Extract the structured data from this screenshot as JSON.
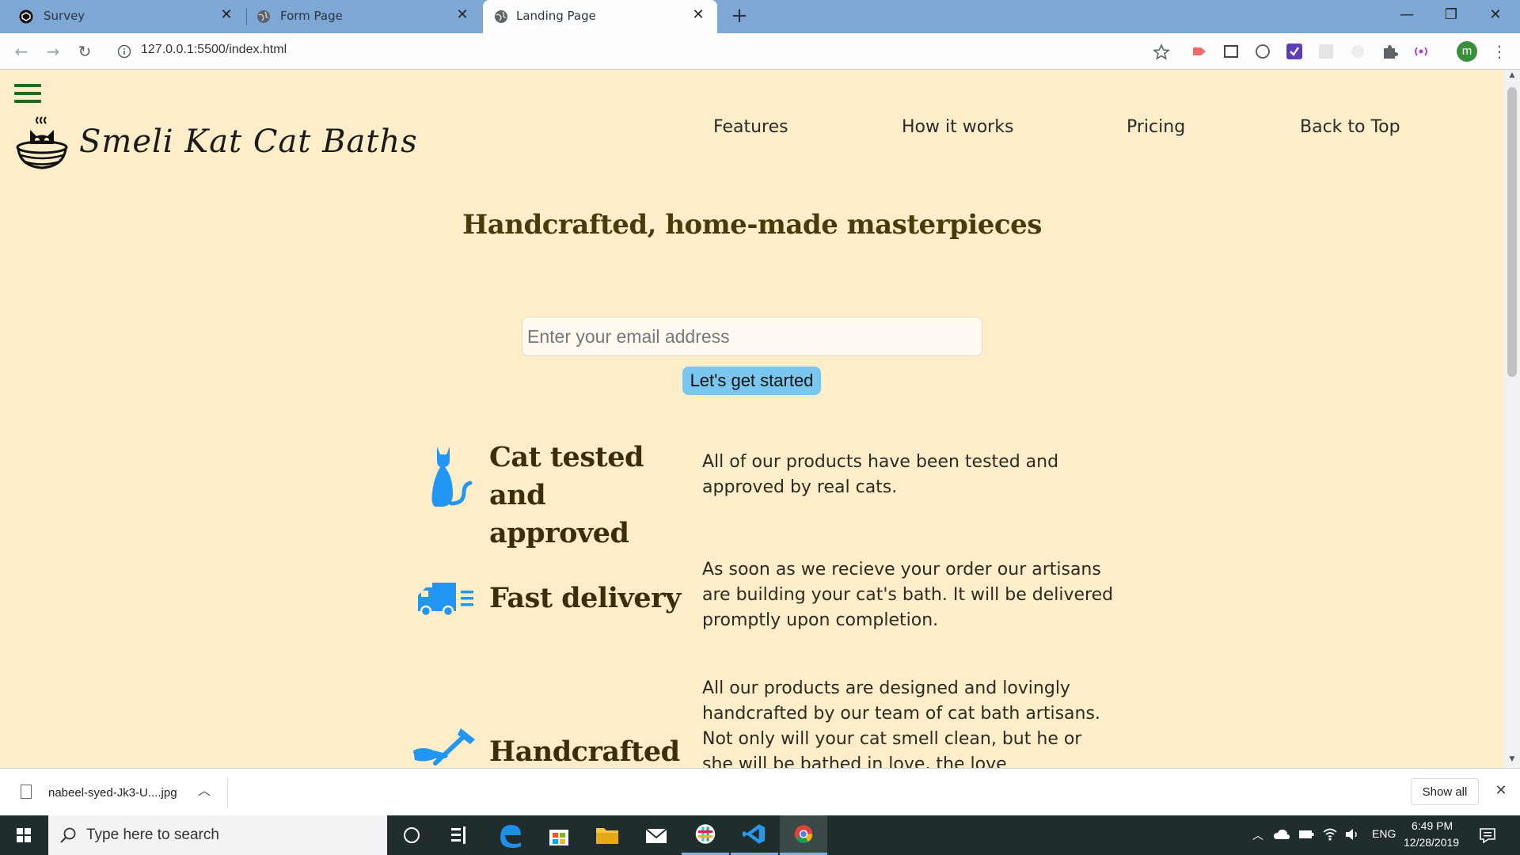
{
  "browser": {
    "tabs": [
      {
        "title": "Survey",
        "icon": "codepen-icon",
        "active": false
      },
      {
        "title": "Form Page",
        "icon": "globe-icon",
        "active": false
      },
      {
        "title": "Landing Page",
        "icon": "globe-icon",
        "active": true
      }
    ],
    "new_tab": "+",
    "url": "127.0.0.1:5500/index.html",
    "profile_initial": "m"
  },
  "site": {
    "name": "Smeli Kat Cat Baths",
    "nav": [
      "Features",
      "How it works",
      "Pricing",
      "Back to Top"
    ]
  },
  "hero": {
    "title": "Handcrafted, home-made masterpieces",
    "email_placeholder": "Enter your email address",
    "cta_label": "Let's get started"
  },
  "features": [
    {
      "icon": "cat-icon",
      "title": "Cat tested and approved",
      "description": "All of our products have been tested and approved by real cats."
    },
    {
      "icon": "delivery-truck-icon",
      "title": "Fast delivery",
      "description": "As soon as we recieve your order our artisans are building your cat's bath. It will be delivered promptly upon completion."
    },
    {
      "icon": "hammer-icon",
      "title": "Handcrafted",
      "description": "All our products are designed and lovingly handcrafted by our team of cat bath artisans. Not only will your cat smell clean, but he or she will be bathed in love, the love"
    }
  ],
  "downloads": {
    "file_name": "nabeel-syed-Jk3-U....jpg",
    "show_all": "Show all"
  },
  "taskbar": {
    "search_placeholder": "Type here to search",
    "language": "ENG",
    "time": "6:49 PM",
    "date": "12/28/2019"
  },
  "colors": {
    "page_background": "#fdedc8",
    "accent_blue": "#2196f3",
    "cta_button": "#79c6ee",
    "heading": "#4b3a0c",
    "hamburger": "#1d6b1d"
  }
}
